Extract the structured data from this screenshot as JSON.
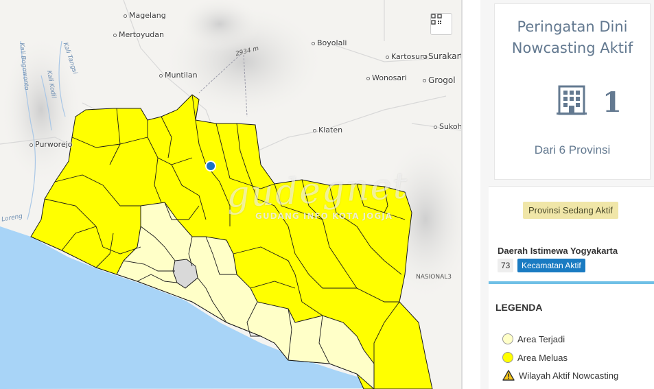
{
  "map": {
    "places": [
      {
        "key": "magelang",
        "label": "Magelang"
      },
      {
        "key": "mertoyudan",
        "label": "Mertoyudan"
      },
      {
        "key": "muntilan",
        "label": "Muntilan"
      },
      {
        "key": "boyolali",
        "label": "Boyolali"
      },
      {
        "key": "kartosuro",
        "label": "Kartosuro"
      },
      {
        "key": "surakarta",
        "label": "Surakart"
      },
      {
        "key": "wonosari",
        "label": "Wonosari"
      },
      {
        "key": "grogol",
        "label": "Grogol"
      },
      {
        "key": "klaten",
        "label": "Klaten"
      },
      {
        "key": "sukohar",
        "label": "Sukohar"
      },
      {
        "key": "purworejo",
        "label": "Purworejo"
      }
    ],
    "rivers": [
      "Kali Tangsi",
      "Kali Kodil",
      "Kali Bogowonto",
      "Loreng"
    ],
    "peak_label": "2934 m",
    "road_label": "NASIONAL3",
    "watermark": "gudegnet",
    "watermark_sub": "GUDANG INFO KOTA JOGJA",
    "fullscreen_icon": "qr-code-icon",
    "colors": {
      "sea": "#a8d4f7",
      "area_meluas": "#ffff00",
      "area_terjadi": "#ffffc8",
      "border": "#1a1a1a",
      "city_core": "#d9d9d9",
      "location_marker": "#1a73c7"
    }
  },
  "sidebar": {
    "summary": {
      "title": "Peringatan Dini Nowcasting Aktif",
      "icon": "building-icon",
      "active_count": "1",
      "province_total": "Dari 6 Provinsi"
    },
    "status_badge": "Provinsi Sedang Aktif",
    "province": {
      "name": "Daerah Istimewa Yogyakarta",
      "kecamatan_count": "73",
      "kecamatan_label": "Kecamatan Aktif"
    },
    "legend": {
      "title": "LEGENDA",
      "items": [
        {
          "label": "Area Terjadi",
          "icon": "pale-yellow-circle"
        },
        {
          "label": "Area Meluas",
          "icon": "yellow-circle"
        },
        {
          "label": "Wilayah Aktif Nowcasting",
          "icon": "warning-triangle-icon"
        }
      ]
    }
  }
}
